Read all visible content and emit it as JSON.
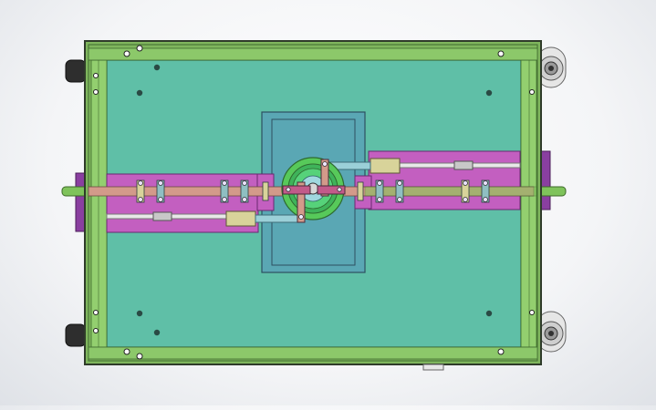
{
  "viewport": {
    "name": "cad-top-view",
    "background": "#f0f1f4"
  },
  "model": {
    "colors": {
      "frame_green": "#8ec96b",
      "frame_edge": "#3f6b2e",
      "plate_teal": "#5fbfa7",
      "center_block_blue": "#5aa7b4",
      "rail_magenta": "#c35fc0",
      "shaft_tan": "#d39a8a",
      "cylinder_khaki": "#d8d39a",
      "hub_green": "#57c95a",
      "wheel_grey": "#d9d9d9",
      "tire_black": "#2b2b2b"
    }
  }
}
